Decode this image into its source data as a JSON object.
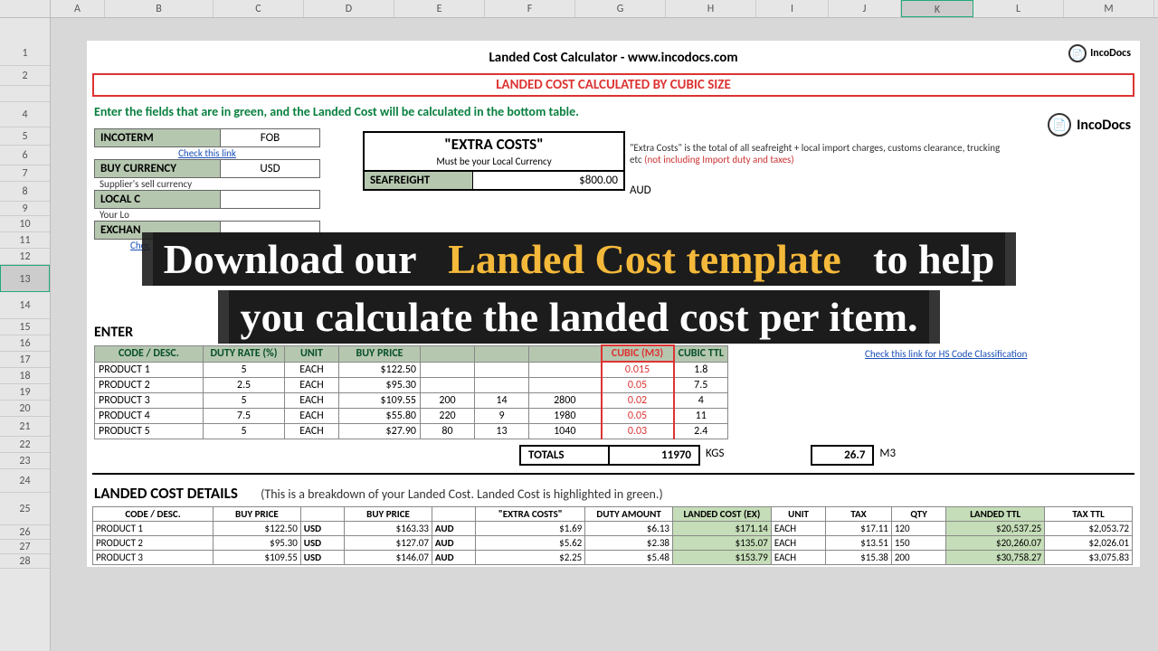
{
  "app_title": "Landed Cost Calculator - www.incodocs.com",
  "brand": "IncoDocs",
  "banner": "LANDED COST CALCULATED BY CUBIC SIZE",
  "instruction": "Enter the fields that are in green, and the Landed Cost will be calculated in the bottom table.",
  "incoterm": {
    "label": "INCOTERM",
    "value": "FOB",
    "link": "Check this link"
  },
  "buy_currency": {
    "label": "BUY CURRENCY",
    "value": "USD",
    "sub": "Supplier's sell currency"
  },
  "local_currency": {
    "label": "LOCAL C",
    "sub": "Your Lo"
  },
  "exchange": {
    "label": "EXCHAN",
    "link": "Chec"
  },
  "extra": {
    "title": "\"EXTRA COSTS\"",
    "sub": "Must be your Local Currency",
    "seafreight_label": "SEAFREIGHT",
    "seafreight_value": "$800.00",
    "seafreight_currency": "AUD",
    "note_pre": "\"Extra Costs\" is the total of all seafreight + local import charges, customs clearance, trucking etc ",
    "note_red": "(not including Import duty and taxes)"
  },
  "enter_title": "ENTER",
  "products_headers": [
    "CODE / DESC.",
    "DUTY RATE (%)",
    "UNIT",
    "BUY PRICE",
    "",
    "",
    "",
    "CUBIC (M3)",
    "CUBIC TTL"
  ],
  "products": [
    {
      "code": "PRODUCT 1",
      "duty": "5",
      "unit": "EACH",
      "buy": "$122.50",
      "c5": "",
      "c6": "",
      "weight": "",
      "cubic": "0.015",
      "ttl": "1.8"
    },
    {
      "code": "PRODUCT 2",
      "duty": "2.5",
      "unit": "EACH",
      "buy": "$95.30",
      "c5": "",
      "c6": "",
      "weight": "",
      "cubic": "0.05",
      "ttl": "7.5"
    },
    {
      "code": "PRODUCT 3",
      "duty": "5",
      "unit": "EACH",
      "buy": "$109.55",
      "c5": "200",
      "c6": "14",
      "weight": "2800",
      "cubic": "0.02",
      "ttl": "4"
    },
    {
      "code": "PRODUCT 4",
      "duty": "7.5",
      "unit": "EACH",
      "buy": "$55.80",
      "c5": "220",
      "c6": "9",
      "weight": "1980",
      "cubic": "0.05",
      "ttl": "11"
    },
    {
      "code": "PRODUCT 5",
      "duty": "5",
      "unit": "EACH",
      "buy": "$27.90",
      "c5": "80",
      "c6": "13",
      "weight": "1040",
      "cubic": "0.03",
      "ttl": "2.4"
    }
  ],
  "totals": {
    "label": "TOTALS",
    "weight": "11970",
    "weight_unit": "KGS",
    "cubic": "26.7",
    "cubic_unit": "M3"
  },
  "hs_link": "Check this link for HS Code Classification",
  "landed_title": "LANDED COST DETAILS",
  "landed_sub": "(This is a breakdown of your Landed Cost.  Landed Cost is highlighted in green.)",
  "landed_headers": [
    "CODE / DESC.",
    "BUY PRICE",
    "",
    "BUY PRICE",
    "",
    "\"EXTRA COSTS\"",
    "DUTY AMOUNT",
    "LANDED COST (EX)",
    "UNIT",
    "TAX",
    "QTY",
    "LANDED TTL",
    "TAX TTL"
  ],
  "landed_rows": [
    {
      "code": "PRODUCT 1",
      "bp": "$122.50",
      "cur": "USD",
      "bp2": "$163.33",
      "cur2": "AUD",
      "extra": "$1.69",
      "duty": "$6.13",
      "landed": "$171.14",
      "unit": "EACH",
      "tax": "$17.11",
      "qty": "120",
      "lttl": "$20,537.25",
      "taxttl": "$2,053.72"
    },
    {
      "code": "PRODUCT 2",
      "bp": "$95.30",
      "cur": "USD",
      "bp2": "$127.07",
      "cur2": "AUD",
      "extra": "$5.62",
      "duty": "$2.38",
      "landed": "$135.07",
      "unit": "EACH",
      "tax": "$13.51",
      "qty": "150",
      "lttl": "$20,260.07",
      "taxttl": "$2,026.01"
    },
    {
      "code": "PRODUCT 3",
      "bp": "$109.55",
      "cur": "USD",
      "bp2": "$146.07",
      "cur2": "AUD",
      "extra": "$2.25",
      "duty": "$5.48",
      "landed": "$153.79",
      "unit": "EACH",
      "tax": "$15.38",
      "qty": "200",
      "lttl": "$30,758.27",
      "taxttl": "$3,075.83"
    }
  ],
  "overlay": {
    "pre": "Download our ",
    "highlight": "Landed Cost template",
    "rest": " to help you calculate the landed cost per item."
  },
  "cols": [
    "A",
    "B",
    "C",
    "D",
    "E",
    "F",
    "G",
    "H",
    "I",
    "J",
    "K",
    "L",
    "M"
  ],
  "rows_labels": [
    "1",
    "2",
    "",
    "4",
    "5",
    "6",
    "7",
    "8",
    "9",
    "10",
    "11",
    "12",
    "13",
    "14",
    "15",
    "16",
    "17",
    "18",
    "19",
    "20",
    "21",
    "22",
    "23",
    "24",
    "25",
    "26",
    "27",
    "28"
  ]
}
